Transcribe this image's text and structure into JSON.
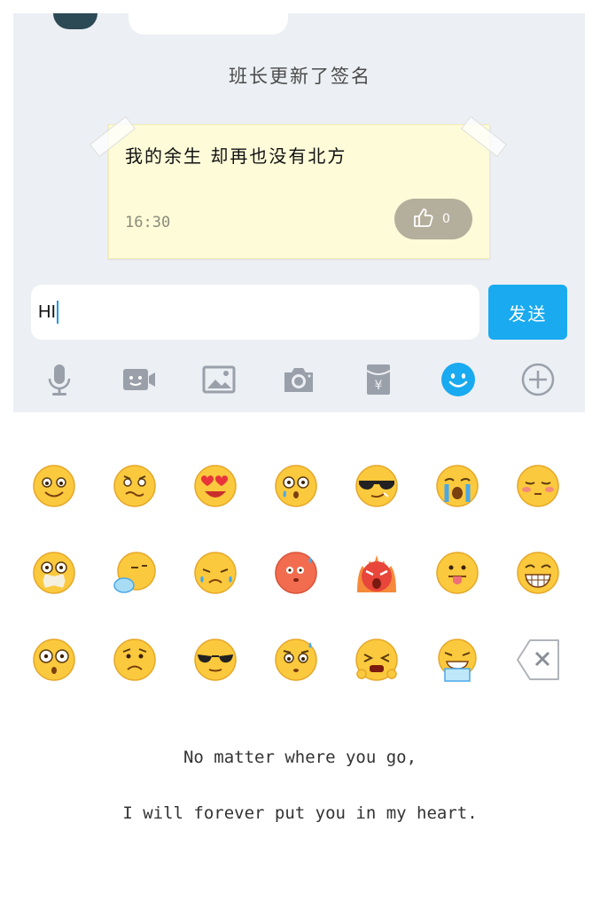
{
  "chat": {
    "system_notice": "班长更新了签名",
    "note": {
      "text": "我的余生 却再也没有北方",
      "time": "16:30",
      "likes": "0"
    }
  },
  "composer": {
    "input_value": "HI",
    "send_label": "发送"
  },
  "toolbar": {
    "icons": [
      "microphone-icon",
      "video-icon",
      "image-icon",
      "camera-icon",
      "red-packet-icon",
      "emoji-icon",
      "plus-icon"
    ],
    "active": "emoji-icon",
    "accent": "#19aaf0"
  },
  "emoji_panel": {
    "rows": [
      [
        "smile-emoji",
        "awkward-emoji",
        "heart-eyes-emoji",
        "shocked-emoji",
        "cool-emoji",
        "crying-emoji",
        "shy-emoji"
      ],
      [
        "silenced-emoji",
        "sleepy-emoji",
        "tearful-emoji",
        "blushing-emoji",
        "angry-emoji",
        "tongue-emoji",
        "grin-emoji"
      ],
      [
        "surprised-emoji",
        "sad-emoji",
        "sunglasses-emoji",
        "nervous-emoji",
        "frustrated-emoji",
        "sob-emoji",
        "delete-key-icon"
      ]
    ]
  },
  "footer": {
    "line1": "No matter where you go,",
    "line2": "I will forever put you in my heart."
  }
}
